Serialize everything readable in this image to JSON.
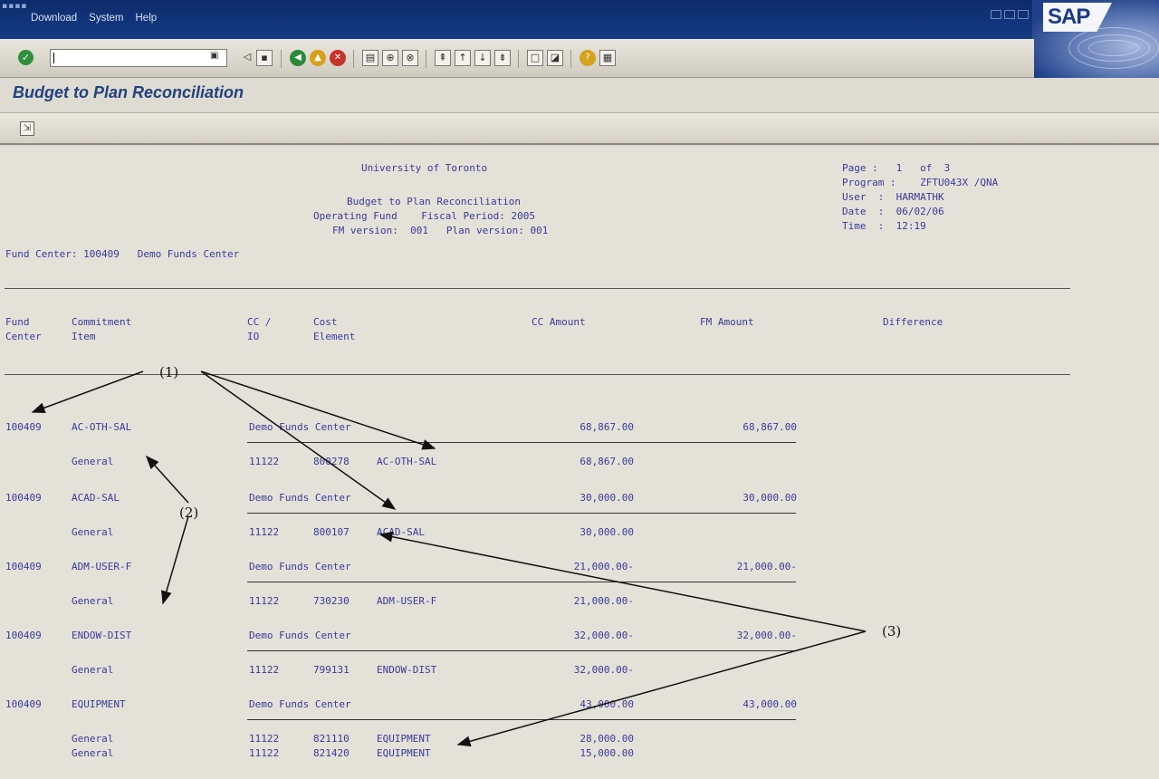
{
  "menu": [
    "Download",
    "System",
    "Help"
  ],
  "window": {
    "title": "Budget to Plan Reconciliation",
    "logo": "SAP"
  },
  "report_header": {
    "org": "University of Toronto",
    "title": "Budget to Plan Reconciliation",
    "fund_line": "Operating Fund    Fiscal Period: 2005",
    "version_line": "FM version:  001   Plan version: 001",
    "fund_center_line": "Fund Center: 100409   Demo Funds Center",
    "page_line": "Page :   1   of  3",
    "program_line": "Program :    ZFTU043X /QNA",
    "user_line": "User  :  HARMATHK",
    "date_line": "Date  :  06/02/06",
    "time_line": "Time  :  12:19"
  },
  "columns": {
    "fund_center": "Fund\nCenter",
    "commitment_item": "Commitment\nItem",
    "cc_io": "CC /\nIO",
    "cost_element": "Cost\nElement",
    "cc_amount": "CC Amount",
    "fm_amount": "FM Amount",
    "difference": "Difference"
  },
  "rows": [
    {
      "fund": "100409",
      "item": "AC-OTH-SAL",
      "desc": "Demo Funds Center",
      "cc_amount": "68,867.00",
      "fm_amount": "68,867.00",
      "sub": [
        {
          "label": "General",
          "io": "11122",
          "ce": "800278",
          "ce_name": "AC-OTH-SAL",
          "amount": "68,867.00"
        }
      ]
    },
    {
      "fund": "100409",
      "item": "ACAD-SAL",
      "desc": "Demo Funds Center",
      "cc_amount": "30,000.00",
      "fm_amount": "30,000.00",
      "sub": [
        {
          "label": "General",
          "io": "11122",
          "ce": "800107",
          "ce_name": "ACAD-SAL",
          "amount": "30,000.00"
        }
      ]
    },
    {
      "fund": "100409",
      "item": "ADM-USER-F",
      "desc": "Demo Funds Center",
      "cc_amount": "21,000.00-",
      "fm_amount": "21,000.00-",
      "sub": [
        {
          "label": "General",
          "io": "11122",
          "ce": "730230",
          "ce_name": "ADM-USER-F",
          "amount": "21,000.00-"
        }
      ]
    },
    {
      "fund": "100409",
      "item": "ENDOW-DIST",
      "desc": "Demo Funds Center",
      "cc_amount": "32,000.00-",
      "fm_amount": "32,000.00-",
      "sub": [
        {
          "label": "General",
          "io": "11122",
          "ce": "799131",
          "ce_name": "ENDOW-DIST",
          "amount": "32,000.00-"
        }
      ]
    },
    {
      "fund": "100409",
      "item": "EQUIPMENT",
      "desc": "Demo Funds Center",
      "cc_amount": "43,000.00",
      "fm_amount": "43,000.00",
      "sub": [
        {
          "label": "General",
          "io": "11122",
          "ce": "821110",
          "ce_name": "EQUIPMENT",
          "amount": "28,000.00"
        },
        {
          "label": "General",
          "io": "11122",
          "ce": "821420",
          "ce_name": "EQUIPMENT",
          "amount": "15,000.00"
        }
      ]
    }
  ],
  "annotations": [
    "(1)",
    "(2)",
    "(3)"
  ]
}
